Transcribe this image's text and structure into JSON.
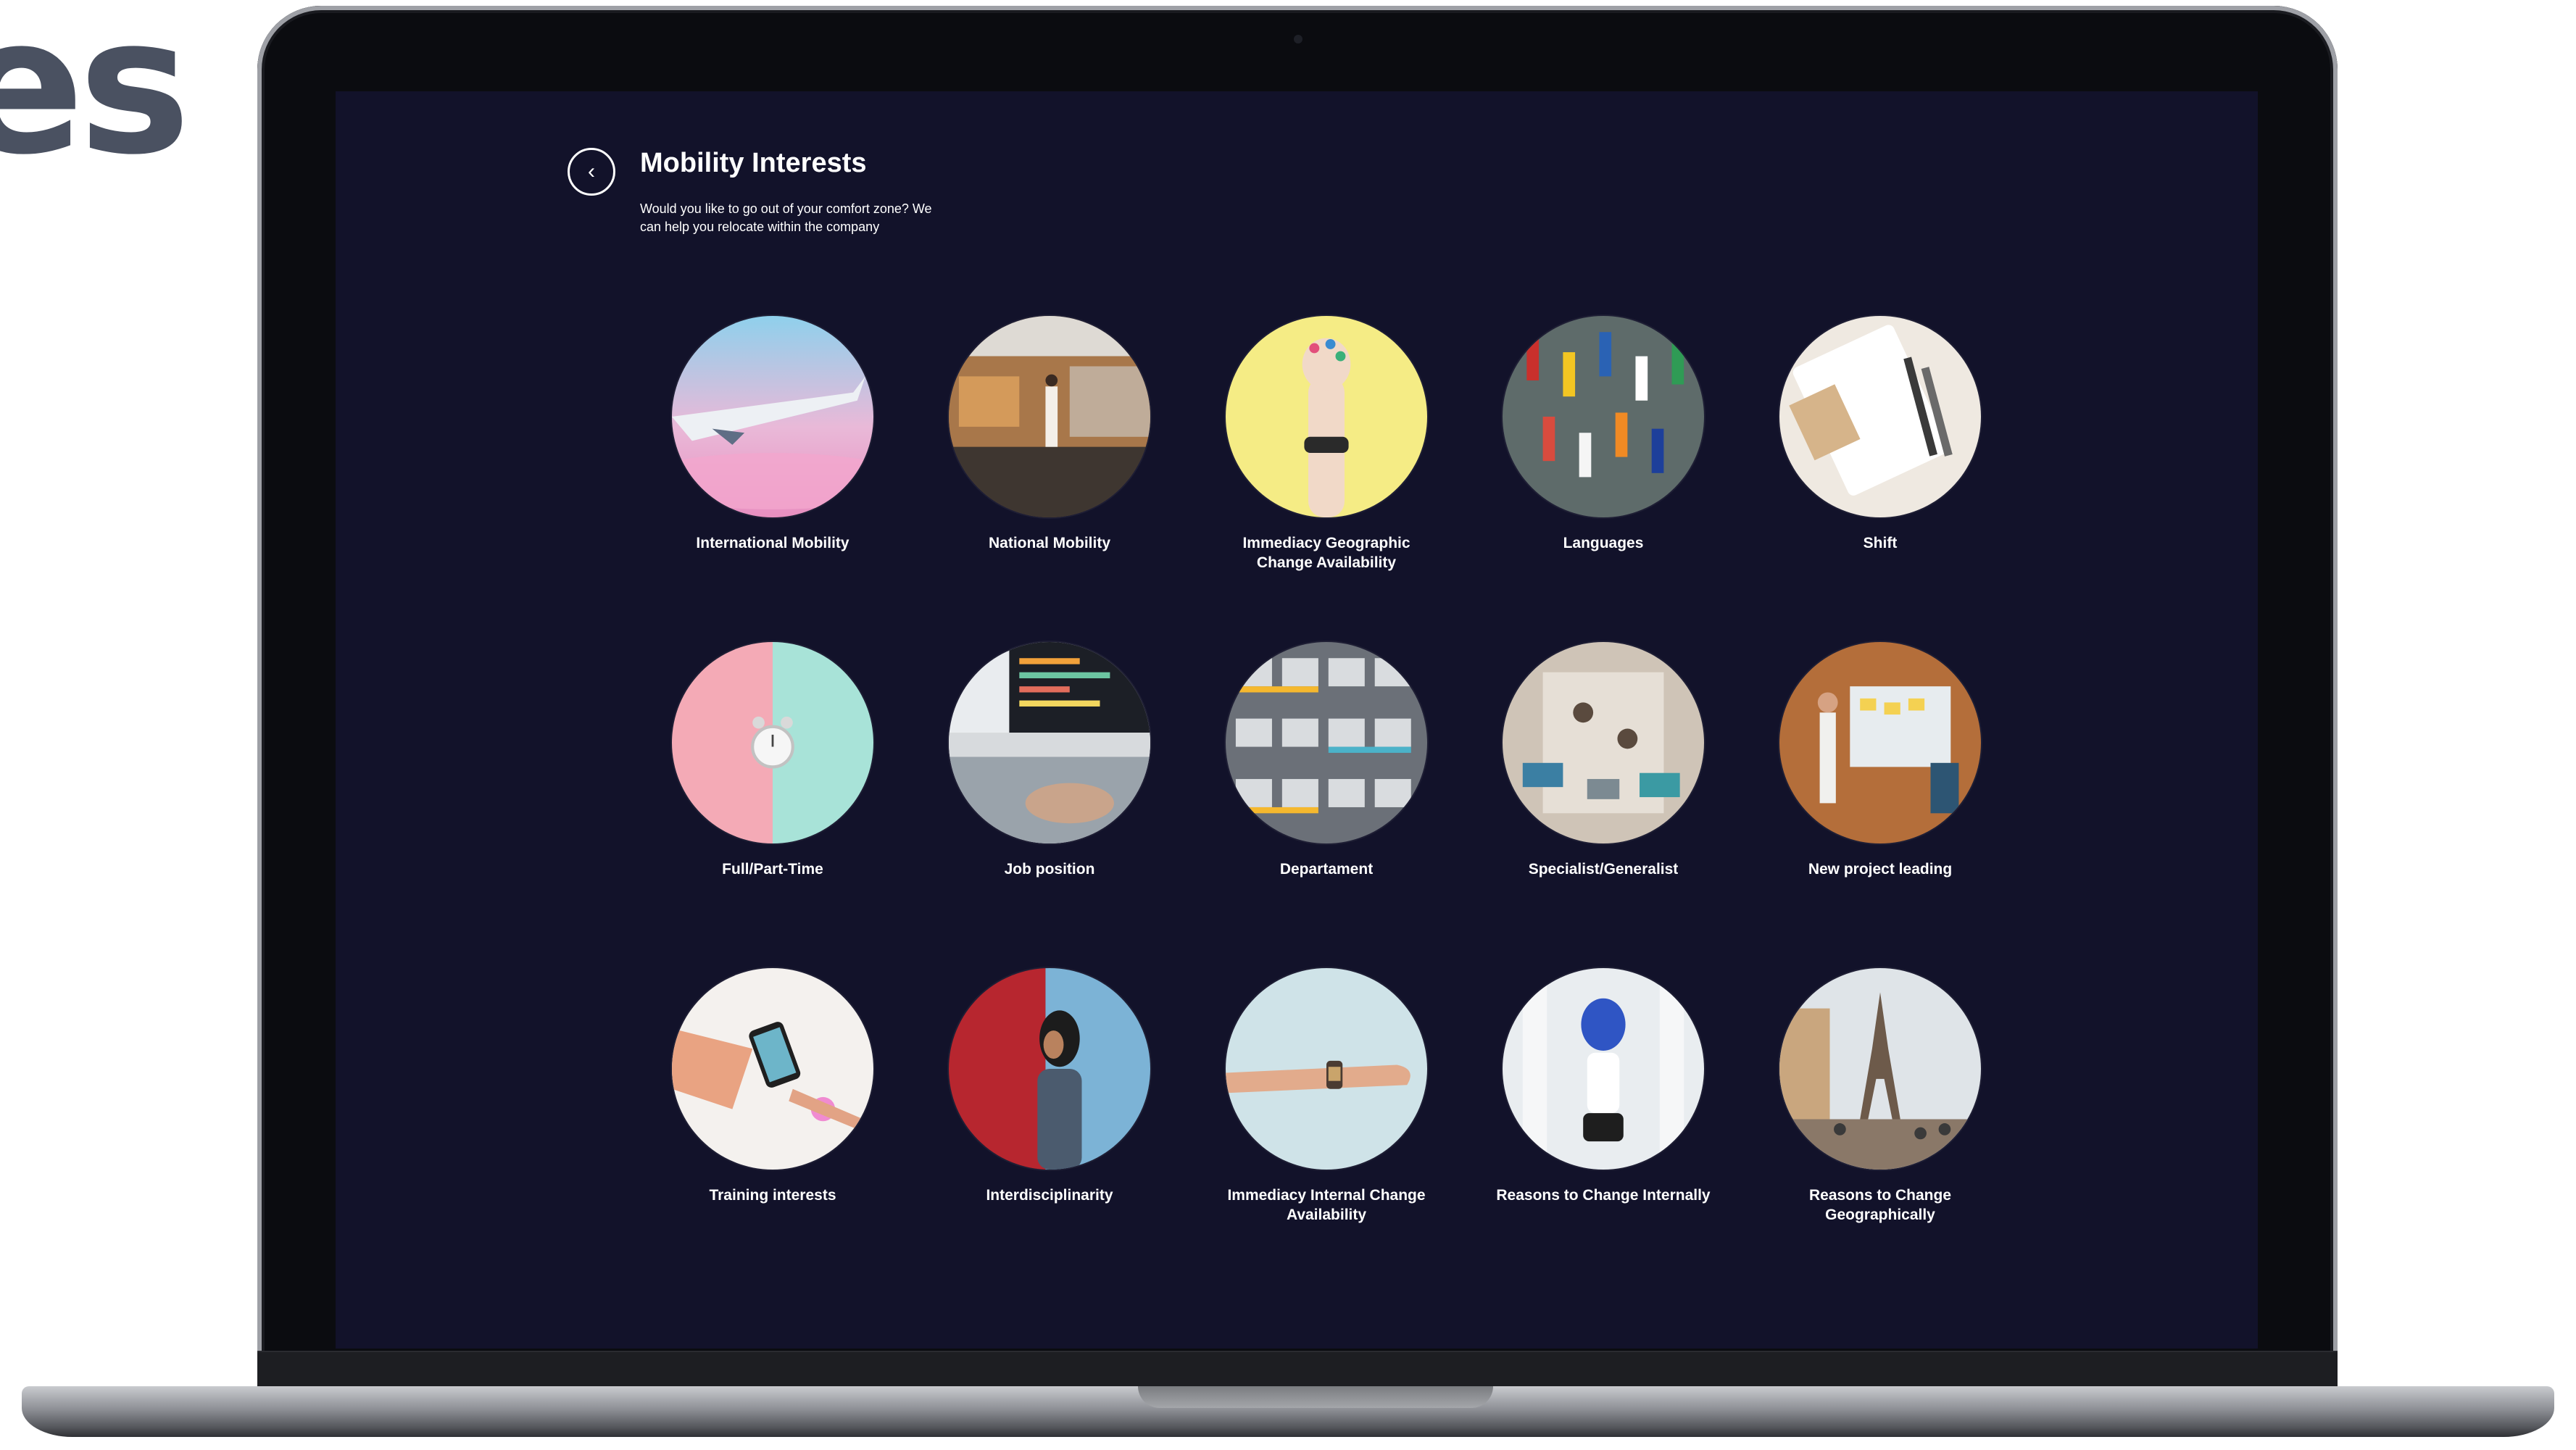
{
  "corner_text": "es",
  "header": {
    "back_icon": "chevron-left-icon",
    "back_glyph": "‹",
    "title": "Mobility Interests",
    "subtitle": "Would you like to go out of your comfort zone? We can help you relocate within the company"
  },
  "tiles": [
    {
      "label": "International Mobility",
      "image": "airplane-wing-over-pink-clouds"
    },
    {
      "label": "National Mobility",
      "image": "person-in-motion-blurred-train"
    },
    {
      "label": "Immediacy Geographic Change Availability",
      "image": "hand-with-watch-yellow-background"
    },
    {
      "label": "Languages",
      "image": "world-flags-on-wall"
    },
    {
      "label": "Shift",
      "image": "planner-and-pens"
    },
    {
      "label": "Full/Part-Time",
      "image": "alarm-clock-pink-mint"
    },
    {
      "label": "Job position",
      "image": "computer-with-code"
    },
    {
      "label": "Departament",
      "image": "building-facade-windows"
    },
    {
      "label": "Specialist/Generalist",
      "image": "team-meeting-table-top-view"
    },
    {
      "label": "New project leading",
      "image": "presentation-whiteboard"
    },
    {
      "label": "Training interests",
      "image": "smartphone-on-desk-sketches"
    },
    {
      "label": "Interdisciplinarity",
      "image": "woman-red-blue-wall"
    },
    {
      "label": "Immediacy Internal Change Availability",
      "image": "arm-with-watch-light-blue"
    },
    {
      "label": "Reasons to Change Internally",
      "image": "person-with-balloon"
    },
    {
      "label": "Reasons to Change Geographically",
      "image": "eiffel-tower-view"
    }
  ],
  "colors": {
    "screen_background": "#12122a",
    "text": "#ffffff"
  }
}
